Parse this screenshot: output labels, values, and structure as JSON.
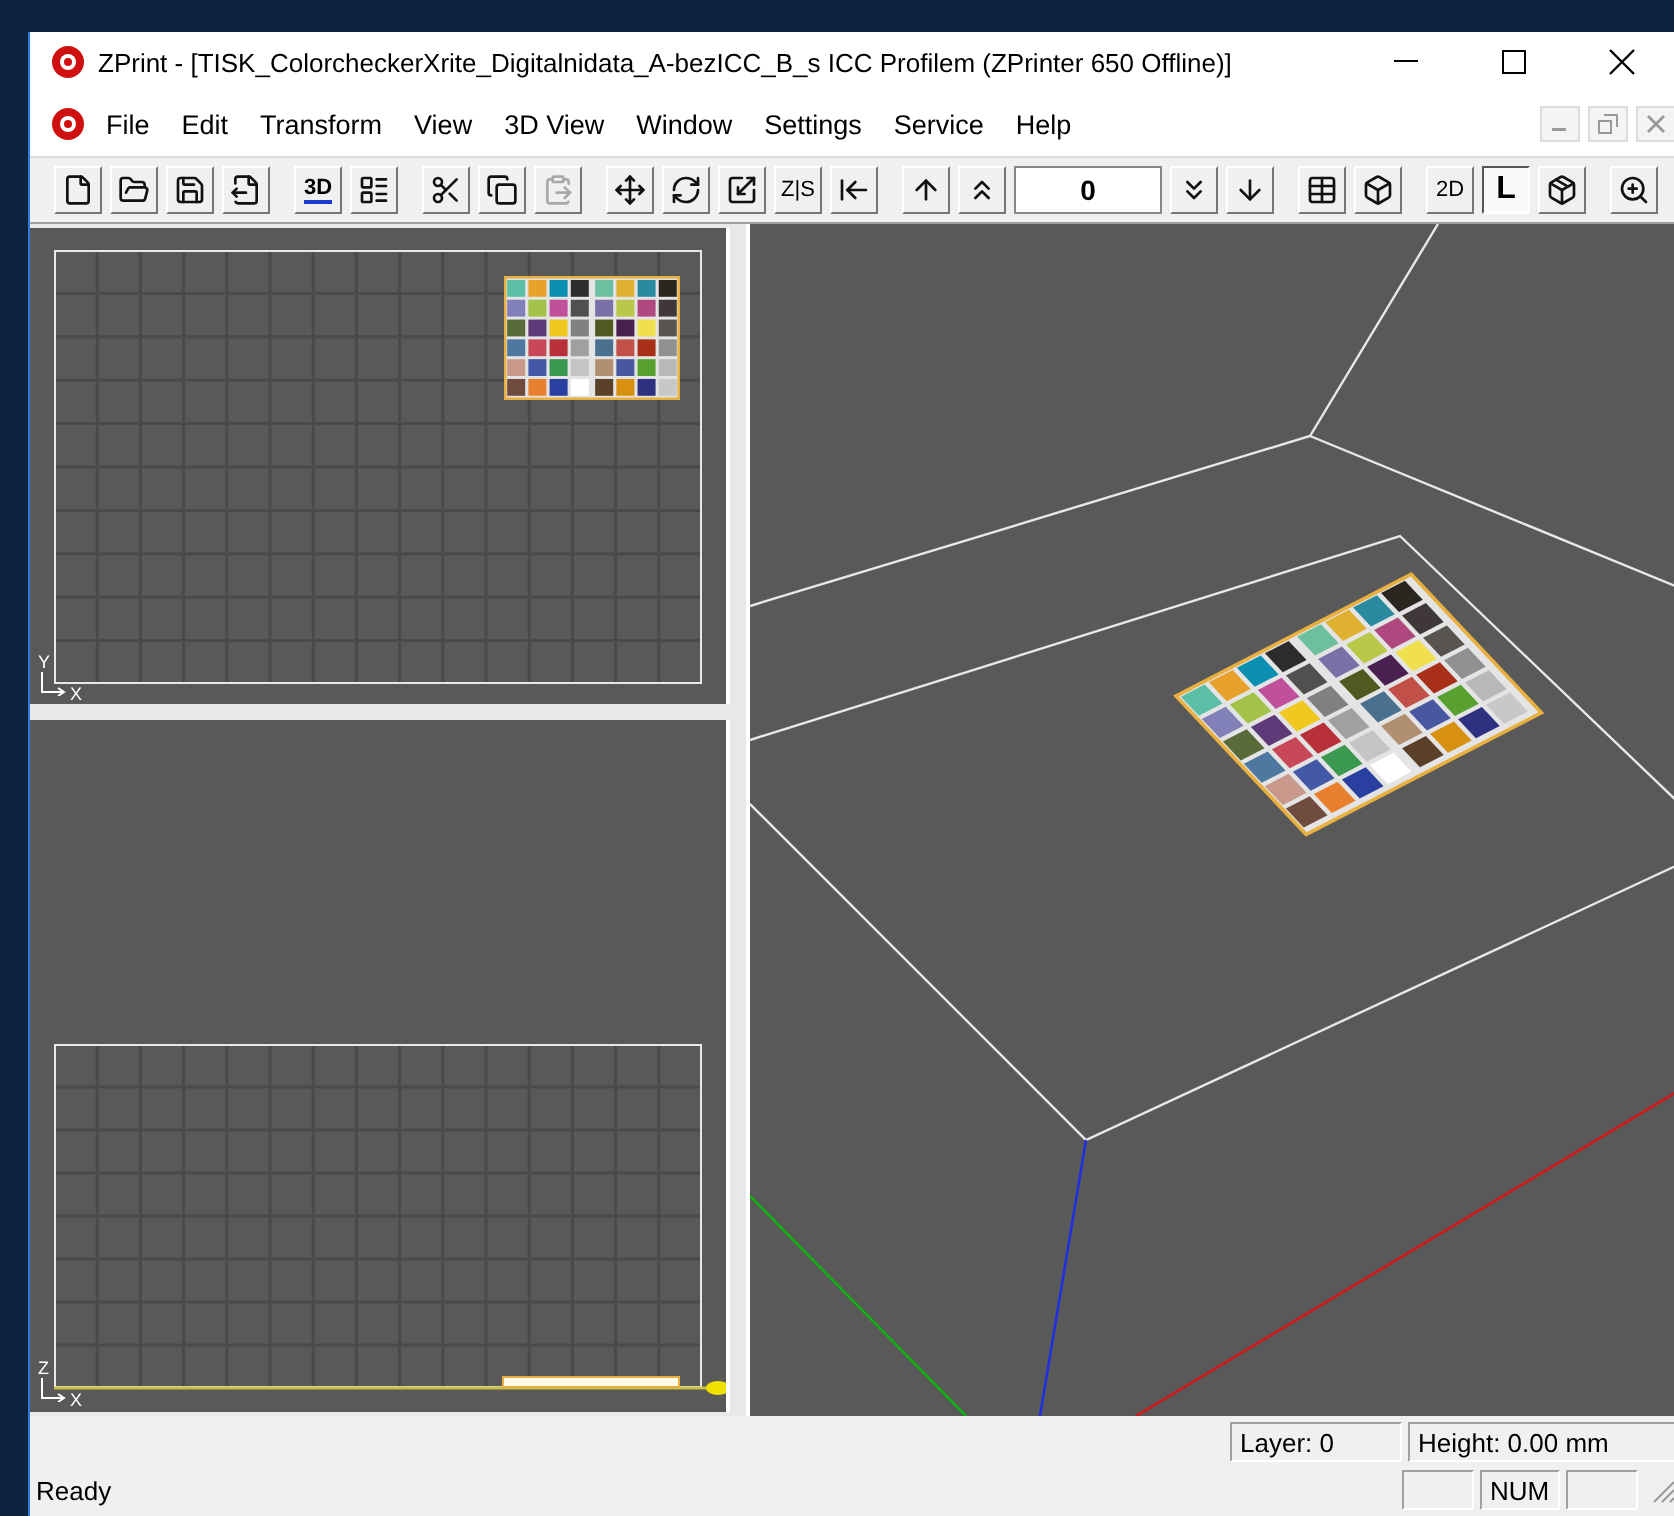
{
  "window": {
    "title": "ZPrint - [TISK_ColorcheckerXrite_Digitalnidata_A-bezICC_B_s ICC Profilem (ZPrinter 650 Offline)]"
  },
  "menu": [
    "File",
    "Edit",
    "Transform",
    "View",
    "3D View",
    "Window",
    "Settings",
    "Service",
    "Help"
  ],
  "toolbar": [
    [
      {
        "kind": "icon",
        "disabled": false
      },
      {
        "kind": "icon",
        "disabled": false
      },
      {
        "kind": "icon",
        "disabled": false
      },
      {
        "kind": "icon",
        "disabled": false
      }
    ],
    [
      {
        "kind": "label",
        "text": "3D",
        "underlined": true,
        "selected": false
      },
      {
        "kind": "icon",
        "disabled": false
      }
    ],
    [
      {
        "kind": "icon",
        "disabled": false
      },
      {
        "kind": "icon",
        "disabled": false
      },
      {
        "kind": "icon",
        "disabled": true
      }
    ],
    [
      {
        "kind": "icon",
        "disabled": false
      },
      {
        "kind": "icon",
        "disabled": false
      },
      {
        "kind": "icon",
        "disabled": false
      },
      {
        "kind": "label",
        "text": "Z|S",
        "underlined": false,
        "selected": false
      },
      {
        "kind": "icon",
        "disabled": false
      }
    ],
    [
      {
        "kind": "icon",
        "disabled": false
      },
      {
        "kind": "icon",
        "disabled": false
      },
      {
        "kind": "field",
        "value": "0"
      },
      {
        "kind": "icon",
        "disabled": false
      },
      {
        "kind": "icon",
        "disabled": false
      }
    ],
    [
      {
        "kind": "icon",
        "disabled": false
      },
      {
        "kind": "icon",
        "disabled": false
      }
    ],
    [
      {
        "kind": "label",
        "text": "2D",
        "underlined": false,
        "selected": false
      },
      {
        "kind": "label",
        "text": "L",
        "underlined": false,
        "selected": true
      },
      {
        "kind": "icon",
        "disabled": false
      }
    ],
    [
      {
        "kind": "icon",
        "disabled": false
      }
    ]
  ],
  "views": {
    "top": {
      "vertical_axis": "Y",
      "horizontal_axis": "X"
    },
    "front": {
      "vertical_axis": "Z",
      "horizontal_axis": "X"
    }
  },
  "status_bar": {
    "layer": "Layer: 0",
    "height": "Height: 0.00 mm",
    "message": "Ready",
    "indicators": [
      {
        "kind": "empty"
      },
      {
        "kind": "text",
        "label": "NUM"
      },
      {
        "kind": "empty"
      }
    ]
  }
}
